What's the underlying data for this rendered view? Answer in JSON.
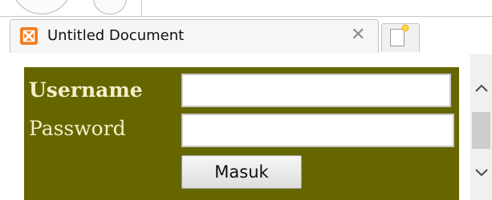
{
  "tab": {
    "title": "Untitled Document",
    "close_glyph": "✕",
    "favicon_icon": "xampp-icon",
    "new_tab_icon": "new-tab-icon"
  },
  "form": {
    "username_label": "Username",
    "password_label": "Password",
    "username_value": "",
    "password_value": "",
    "submit_label": "Masuk",
    "background_color": "#666600",
    "label_color": "#f2efc8"
  },
  "scrollbar": {
    "up_icon": "chevron-up-icon",
    "down_icon": "chevron-down-icon"
  }
}
